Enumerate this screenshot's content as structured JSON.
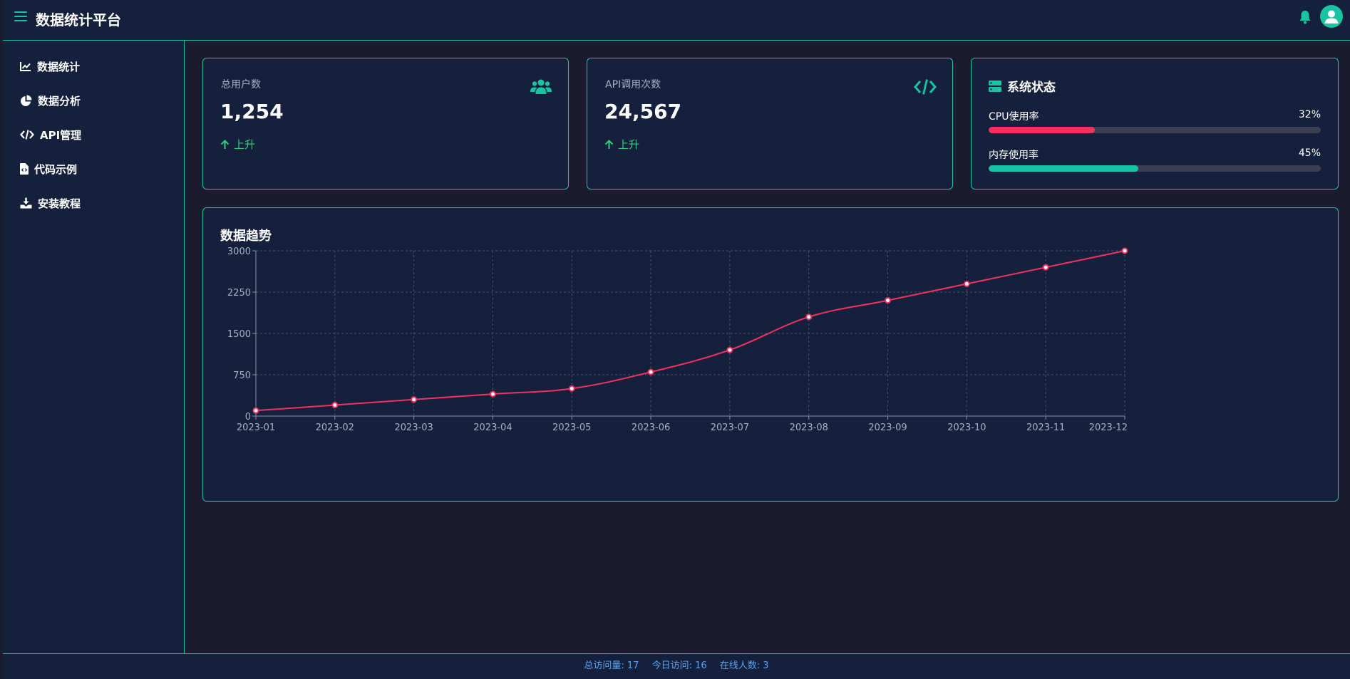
{
  "header": {
    "menu_icon": "hamburger-icon",
    "title": "数据统计平台",
    "notification_icon": "bell-icon",
    "avatar_icon": "user-icon"
  },
  "sidebar": {
    "items": [
      {
        "label": "数据统计",
        "icon": "line-chart-icon"
      },
      {
        "label": "数据分析",
        "icon": "pie-chart-icon"
      },
      {
        "label": "API管理",
        "icon": "code-icon"
      },
      {
        "label": "代码示例",
        "icon": "file-code-icon"
      },
      {
        "label": "安装教程",
        "icon": "download-icon"
      }
    ]
  },
  "stats": {
    "users": {
      "label": "总用户数",
      "value": "1,254",
      "trend": "上升",
      "icon": "users-icon"
    },
    "api": {
      "label": "API调用次数",
      "value": "24,567",
      "trend": "上升",
      "icon": "code-icon"
    }
  },
  "system": {
    "title": "系统状态",
    "icon": "server-icon",
    "cpu": {
      "label": "CPU使用率",
      "value_text": "32%",
      "percent": 32,
      "color": "#f1325e"
    },
    "memory": {
      "label": "内存使用率",
      "value_text": "45%",
      "percent": 45,
      "color": "#19c4a4"
    }
  },
  "chart_card": {
    "title": "数据趋势"
  },
  "chart_data": {
    "type": "line",
    "title": "数据趋势",
    "xlabel": "",
    "ylabel": "",
    "categories": [
      "2023-01",
      "2023-02",
      "2023-03",
      "2023-04",
      "2023-05",
      "2023-06",
      "2023-07",
      "2023-08",
      "2023-09",
      "2023-10",
      "2023-11",
      "2023-12"
    ],
    "series": [
      {
        "values": [
          100,
          200,
          300,
          400,
          500,
          800,
          1200,
          1800,
          2100,
          2400,
          2700,
          3000
        ],
        "color": "#f1325e"
      }
    ],
    "ylim": [
      0,
      3000
    ],
    "yticks": [
      0,
      750,
      1500,
      2250,
      3000
    ],
    "grid": true,
    "smooth": true
  },
  "footer": {
    "total_visits": "总访问量: 17",
    "today_visits": "今日访问: 16",
    "online_users": "在线人数: 3"
  },
  "colors": {
    "accent": "#19c4a4",
    "background": "#1a1b2c",
    "panel": "#15203d",
    "trend_up": "#2fd17b",
    "footer_text": "#5aa3ee"
  }
}
